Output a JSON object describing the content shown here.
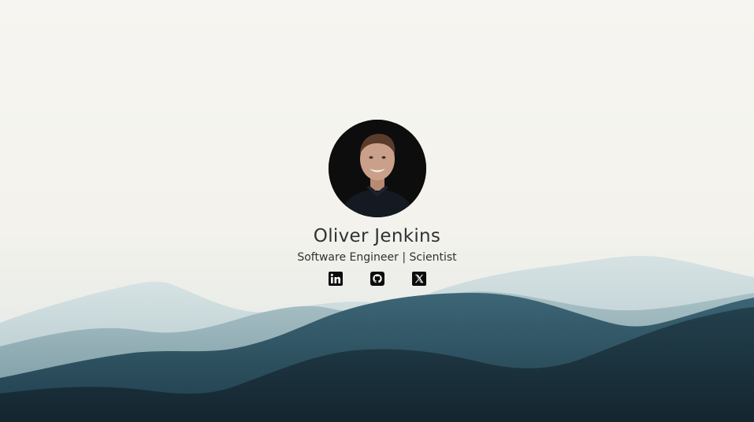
{
  "profile": {
    "name": "Oliver Jenkins",
    "tagline": "Software Engineer | Scientist"
  },
  "socials": [
    {
      "icon": "linkedin-icon",
      "label": "LinkedIn"
    },
    {
      "icon": "github-icon",
      "label": "GitHub"
    },
    {
      "icon": "x-icon",
      "label": "X"
    }
  ],
  "colors": {
    "background": "#f6f5f1",
    "mountain_far": "#b9cdd1",
    "mountain_mid": "#7f9fa8",
    "mountain_near": "#294d5d",
    "mountain_front": "#19303d",
    "text": "#2f3234"
  }
}
